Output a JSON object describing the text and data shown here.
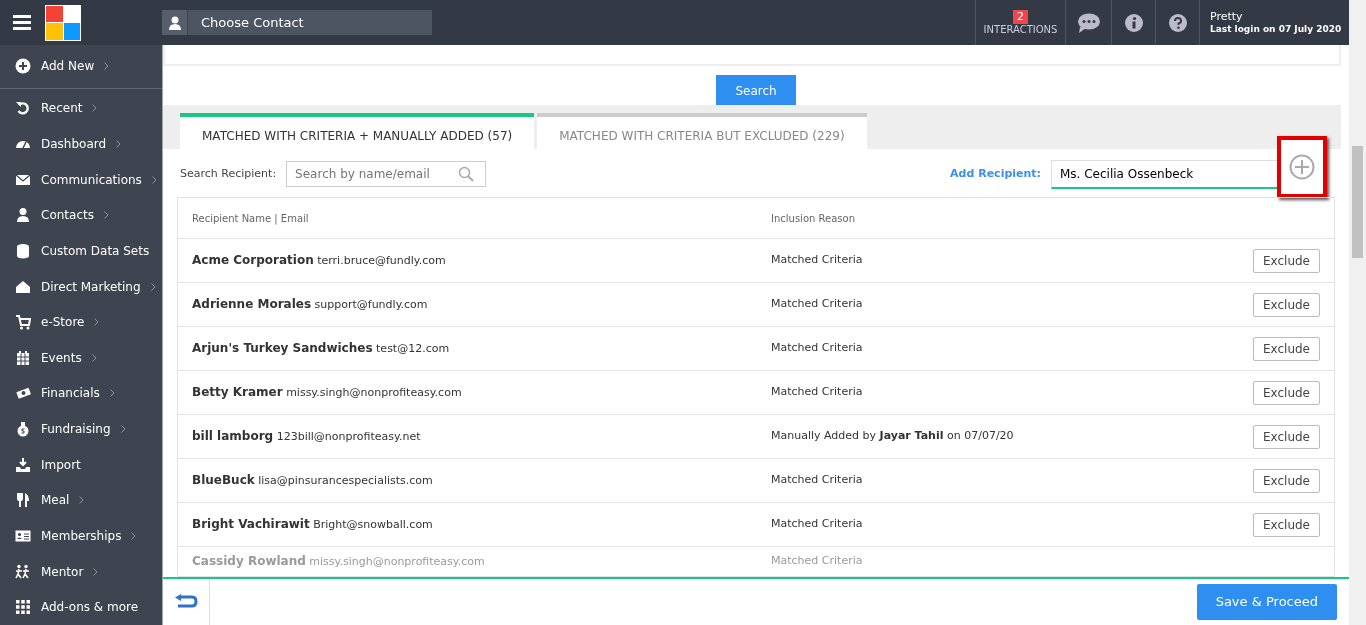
{
  "topbar": {
    "contact_placeholder": "Choose Contact",
    "interactions": {
      "count": "2",
      "label": "INTERACTIONS"
    },
    "user": {
      "name": "Pretty",
      "last_login": "Last login on 07 July 2020"
    }
  },
  "sidebar": {
    "items": [
      {
        "label": "Add New",
        "has_submenu": true
      },
      {
        "label": "Recent",
        "has_submenu": true
      },
      {
        "label": "Dashboard",
        "has_submenu": true
      },
      {
        "label": "Communications",
        "has_submenu": true
      },
      {
        "label": "Contacts",
        "has_submenu": true
      },
      {
        "label": "Custom Data Sets",
        "has_submenu": false
      },
      {
        "label": "Direct Marketing",
        "has_submenu": true
      },
      {
        "label": "e-Store",
        "has_submenu": true
      },
      {
        "label": "Events",
        "has_submenu": true
      },
      {
        "label": "Financials",
        "has_submenu": true
      },
      {
        "label": "Fundraising",
        "has_submenu": true
      },
      {
        "label": "Import",
        "has_submenu": false
      },
      {
        "label": "Meal",
        "has_submenu": true
      },
      {
        "label": "Memberships",
        "has_submenu": true
      },
      {
        "label": "Mentor",
        "has_submenu": true
      },
      {
        "label": "Add-ons & more",
        "has_submenu": false
      }
    ]
  },
  "search_button": "Search",
  "tabs": [
    {
      "label": "MATCHED WITH CRITERIA + MANUALLY ADDED (57)",
      "selected": true
    },
    {
      "label": "MATCHED WITH CRITERIA BUT EXCLUDED (229)",
      "selected": false
    }
  ],
  "search_recipient": {
    "label": "Search Recipient:",
    "placeholder": "Search by name/email"
  },
  "add_recipient": {
    "label": "Add Recipient:",
    "value": "Ms. Cecilia Ossenbeck",
    "highlighted": true
  },
  "table": {
    "columns": [
      "Recipient Name | Email",
      "Inclusion Reason"
    ],
    "rows": [
      {
        "name": "Acme Corporation",
        "email": "terri.bruce@fundly.com",
        "reason": "Matched Criteria",
        "action": "Exclude",
        "dimmed": false
      },
      {
        "name": "Adrienne Morales",
        "email": "support@fundly.com",
        "reason": "Matched Criteria",
        "action": "Exclude",
        "dimmed": false
      },
      {
        "name": "Arjun's Turkey Sandwiches",
        "email": "test@12.com",
        "reason": "Matched Criteria",
        "action": "Exclude",
        "dimmed": false
      },
      {
        "name": "Betty Kramer",
        "email": "missy.singh@nonprofiteasy.com",
        "reason": "Matched Criteria",
        "action": "Exclude",
        "dimmed": false
      },
      {
        "name": "bill lamborg",
        "email": "123bill@nonprofiteasy.net",
        "reason": "Manually Added by **Jayar Tahil** on 07/07/20",
        "action": "Exclude",
        "dimmed": false
      },
      {
        "name": "BlueBuck",
        "email": "lisa@pinsurancespecialists.com",
        "reason": "Matched Criteria",
        "action": "Exclude",
        "dimmed": false
      },
      {
        "name": "Bright Vachirawit",
        "email": "Bright@snowball.com",
        "reason": "Matched Criteria",
        "action": "Exclude",
        "dimmed": false
      },
      {
        "name": "Cassidy Rowland",
        "email": "missy.singh@nonprofiteasy.com",
        "reason": "Matched Criteria",
        "dimmed": true
      }
    ]
  },
  "footer": {
    "primary_button": "Save & Proceed"
  }
}
